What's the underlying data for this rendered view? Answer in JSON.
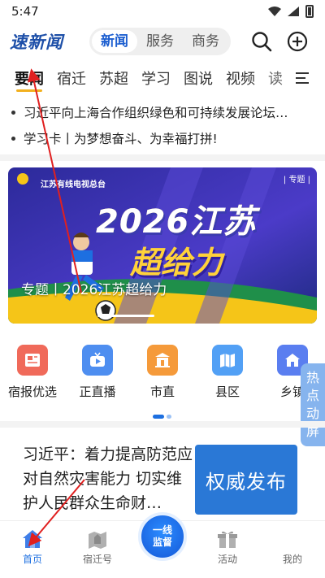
{
  "status_bar": {
    "time": "5:47"
  },
  "header": {
    "logo_text": "速新闻",
    "segments": [
      "新闻",
      "服务",
      "商务"
    ],
    "active_segment": "新闻"
  },
  "channels": [
    "要闻",
    "宿迁",
    "苏超",
    "学习",
    "图说",
    "视频",
    "读"
  ],
  "headlines": [
    "习近平向上海合作组织绿色和可持续发展论坛…",
    "学习卡丨为梦想奋斗、为幸福打拼!"
  ],
  "banner": {
    "org": "江苏有线电视总台",
    "topic_tag": "| 专题 |",
    "title_line1": "2026江苏",
    "title_line2": "超给力",
    "caption": "专题丨2026江苏超给力"
  },
  "quick_links": [
    "宿报优选",
    "正直播",
    "市直",
    "县区",
    "乡镇"
  ],
  "hot_tab": [
    "热",
    "点",
    "动",
    "屏"
  ],
  "news_card": {
    "text": "习近平：着力提高防范应对自然灾害能力 切实维护人民群众生命财…",
    "badge": "权威发布"
  },
  "bottom_nav": {
    "home": "首页",
    "suqian": "宿迁号",
    "center_line1": "一线",
    "center_line2": "监督",
    "activity": "活动",
    "mine": "我的"
  },
  "colors": {
    "accent": "#1d6fe0",
    "annotation_arrow": "#e02020",
    "tab_underline": "#f2b01e"
  }
}
